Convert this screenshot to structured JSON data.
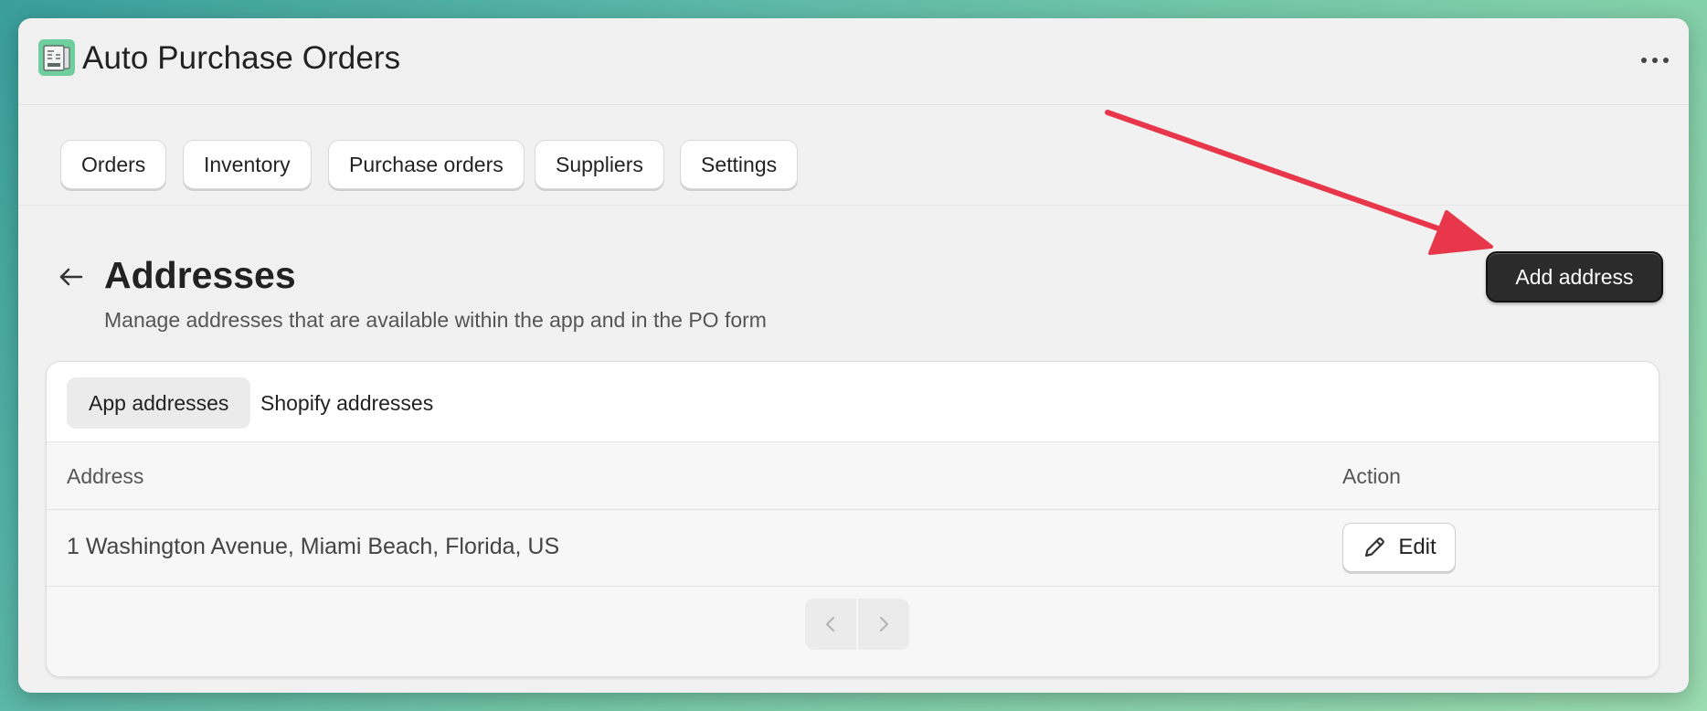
{
  "app": {
    "title": "Auto Purchase Orders"
  },
  "nav": {
    "items": [
      {
        "label": "Orders"
      },
      {
        "label": "Inventory"
      },
      {
        "label": "Purchase orders"
      },
      {
        "label": "Suppliers"
      },
      {
        "label": "Settings"
      }
    ]
  },
  "page": {
    "title": "Addresses",
    "subtitle": "Manage addresses that are available within the app and in the PO form",
    "primary_action": "Add address"
  },
  "tabs": [
    {
      "label": "App addresses",
      "active": true
    },
    {
      "label": "Shopify addresses",
      "active": false
    }
  ],
  "table": {
    "columns": [
      "Address",
      "Action"
    ],
    "rows": [
      {
        "address": "1 Washington Avenue, Miami Beach, Florida, US",
        "action": "Edit"
      }
    ]
  },
  "colors": {
    "primary_button": "#2b2b2b",
    "annotation_arrow": "#e8364a",
    "app_icon": "#6fcf9f"
  }
}
